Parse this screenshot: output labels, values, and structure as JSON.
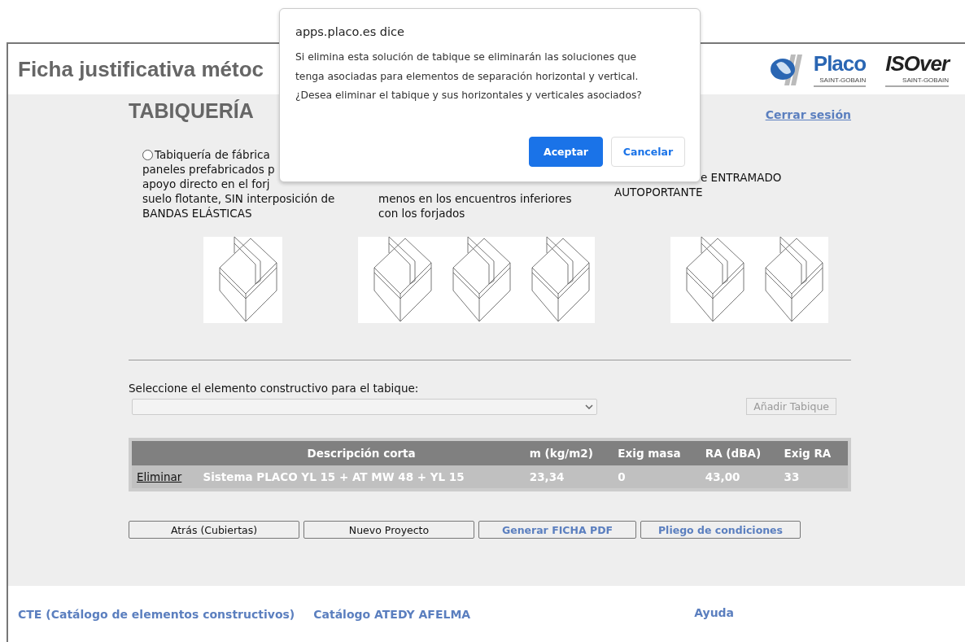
{
  "header": {
    "title": "Ficha justificativa métoc",
    "logos": [
      {
        "name": "Placo",
        "sub": "SAINT-GOBAIN"
      },
      {
        "name": "ISOver",
        "sub": "SAINT-GOBAIN"
      }
    ]
  },
  "section": {
    "title": "TABIQUERÍA",
    "logout": "Cerrar sesión"
  },
  "options": [
    {
      "selected": false,
      "kind": "radio",
      "lines": [
        "Tabiquería de fábrica",
        "paneles prefabricados p",
        "apoyo directo en el forj",
        "suelo flotante, SIN interposición de",
        "BANDAS ELÁSTICAS"
      ]
    },
    {
      "kind": "text",
      "lines": [
        "menos en los encuentros inferiores",
        "con los forjados"
      ]
    },
    {
      "kind": "text",
      "lines": [
        "e ENTRAMADO",
        "AUTOPORTANTE"
      ]
    }
  ],
  "element_select": {
    "label": "Seleccione el elemento constructivo para el tabique:",
    "disabled": true,
    "add_button": "Añadir Tabique"
  },
  "table": {
    "columns": [
      "",
      "Descripción corta",
      "m (kg/m2)",
      "Exig masa",
      "RA (dBA)",
      "Exig RA"
    ],
    "rows": [
      [
        "Eliminar",
        "Sistema PLACO YL 15 + AT MW 48 + YL 15",
        "23,34",
        "0",
        "43,00",
        "33"
      ]
    ]
  },
  "actions": [
    {
      "label": "Atrás (Cubiertas)",
      "kind": "plain"
    },
    {
      "label": "Nuevo Proyecto",
      "kind": "plain"
    },
    {
      "label": "Generar FICHA PDF",
      "kind": "link"
    },
    {
      "label": "Pliego de condiciones",
      "kind": "link"
    }
  ],
  "footer": {
    "links": [
      "CTE (Catálogo de elementos constructivos)",
      "Catálogo ATEDY AFELMA"
    ],
    "help": "Ayuda"
  },
  "dialog": {
    "title": "apps.placo.es dice",
    "message": [
      "Si elimina esta solución de tabique se eliminarán las soluciones que",
      "tenga asociadas para elementos de separación horizontal y vertical.",
      "¿Desea eliminar el tabique y sus horizontales y verticales asociados?"
    ],
    "buttons": [
      {
        "label": "Aceptar",
        "primary": true
      },
      {
        "label": "Cancelar",
        "primary": false
      }
    ]
  }
}
